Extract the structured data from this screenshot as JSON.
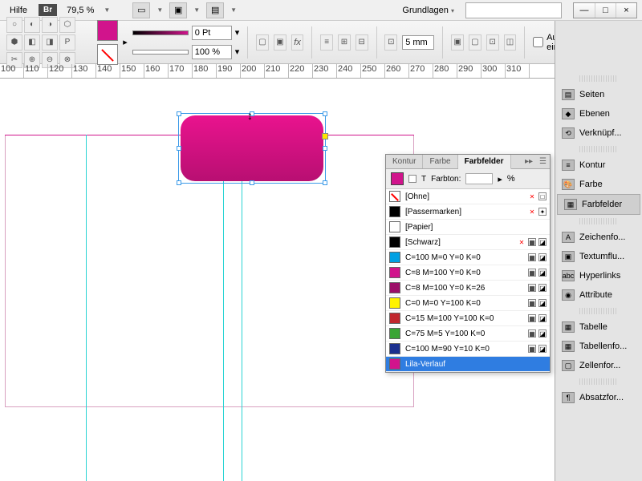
{
  "topbar": {
    "help": "Hilfe",
    "bridge": "Br",
    "zoom": "79,5 %",
    "workspace": "Grundlagen"
  },
  "ctrlbar": {
    "stroke_weight": "0 Pt",
    "opacity": "100 %",
    "fit_gap": "5 mm",
    "autofit": "Automatisch einpassen"
  },
  "ruler": {
    "ticks": [
      "100",
      "110",
      "120",
      "130",
      "140",
      "150",
      "160",
      "170",
      "180",
      "190",
      "200",
      "210",
      "220",
      "230",
      "240",
      "250",
      "260",
      "270",
      "280",
      "290",
      "300",
      "310"
    ]
  },
  "dock": {
    "items": [
      {
        "label": "Seiten",
        "icon": "▤"
      },
      {
        "label": "Ebenen",
        "icon": "◆"
      },
      {
        "label": "Verknüpf...",
        "icon": "⟲"
      }
    ],
    "items2": [
      {
        "label": "Kontur",
        "icon": "≡"
      },
      {
        "label": "Farbe",
        "icon": "🎨"
      },
      {
        "label": "Farbfelder",
        "icon": "▦",
        "active": true
      }
    ],
    "items3": [
      {
        "label": "Zeichenfo...",
        "icon": "A"
      },
      {
        "label": "Textumflu...",
        "icon": "▣"
      },
      {
        "label": "Hyperlinks",
        "icon": "abc"
      },
      {
        "label": "Attribute",
        "icon": "◉"
      }
    ],
    "items4": [
      {
        "label": "Tabelle",
        "icon": "▦"
      },
      {
        "label": "Tabellenfo...",
        "icon": "▦"
      },
      {
        "label": "Zellenfor...",
        "icon": "▢"
      }
    ],
    "items5": [
      {
        "label": "Absatzfor...",
        "icon": "¶"
      }
    ]
  },
  "swatches": {
    "tabs": [
      "Kontur",
      "Farbe",
      "Farbfelder"
    ],
    "tint_label": "Farbton:",
    "tint_unit": "%",
    "rows": [
      {
        "name": "[Ohne]",
        "color": "none",
        "flags": [
          "x",
          "□"
        ]
      },
      {
        "name": "[Passermarken]",
        "color": "#000000",
        "flags": [
          "x",
          "✦"
        ]
      },
      {
        "name": "[Papier]",
        "color": "#ffffff",
        "flags": []
      },
      {
        "name": "[Schwarz]",
        "color": "#000000",
        "flags": [
          "x",
          "▦",
          "◪"
        ]
      },
      {
        "name": "C=100 M=0 Y=0 K=0",
        "color": "#00a0e3",
        "flags": [
          "▦",
          "◪"
        ]
      },
      {
        "name": "C=8 M=100 Y=0 K=0",
        "color": "#d1148c",
        "flags": [
          "▦",
          "◪"
        ]
      },
      {
        "name": "C=8 M=100 Y=0 K=26",
        "color": "#9c0f68",
        "flags": [
          "▦",
          "◪"
        ]
      },
      {
        "name": "C=0 M=0 Y=100 K=0",
        "color": "#fff200",
        "flags": [
          "▦",
          "◪"
        ]
      },
      {
        "name": "C=15 M=100 Y=100 K=0",
        "color": "#c1272d",
        "flags": [
          "▦",
          "◪"
        ]
      },
      {
        "name": "C=75 M=5 Y=100 K=0",
        "color": "#3aa535",
        "flags": [
          "▦",
          "◪"
        ]
      },
      {
        "name": "C=100 M=90 Y=10 K=0",
        "color": "#1b2f8f",
        "flags": [
          "▦",
          "◪"
        ]
      },
      {
        "name": "Lila-Verlauf",
        "color": "#d1148c",
        "flags": [],
        "selected": true
      }
    ]
  }
}
